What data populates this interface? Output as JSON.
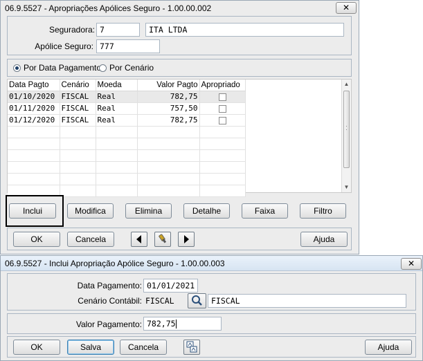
{
  "window1": {
    "title": "06.9.5527 - Apropriações Apólices Seguro - 1.00.00.002",
    "close_label": "✕",
    "seguradora_label": "Seguradora:",
    "seguradora_code": "7",
    "seguradora_name": "ITA LTDA",
    "apolice_label": "Apólice Seguro:",
    "apolice_value": "777",
    "radio_data_label": "Por Data Pagamento",
    "radio_cenario_label": "Por Cenário",
    "selected_radio": "Por Data Pagamento",
    "grid": {
      "columns": [
        "Data Pagto",
        "Cenário",
        "Moeda",
        "Valor Pagto",
        "Apropriado"
      ],
      "rows": [
        [
          "01/10/2020",
          "FISCAL",
          "Real",
          "782,75",
          false
        ],
        [
          "01/11/2020",
          "FISCAL",
          "Real",
          "757,50",
          false
        ],
        [
          "01/12/2020",
          "FISCAL",
          "Real",
          "782,75",
          false
        ]
      ]
    },
    "buttons": {
      "inclui": "Inclui",
      "modifica": "Modifica",
      "elimina": "Elimina",
      "detalhe": "Detalhe",
      "faixa": "Faixa",
      "filtro": "Filtro",
      "ok": "OK",
      "cancela": "Cancela",
      "ajuda": "Ajuda"
    }
  },
  "window2": {
    "title": "06.9.5527 - Inclui Apropriação Apólice Seguro - 1.00.00.003",
    "close_label": "✕",
    "data_pagamento_label": "Data Pagamento:",
    "data_pagamento_value": "01/01/2021",
    "cenario_label": "Cenário Contábil:",
    "cenario_code": "FISCAL",
    "cenario_name": "FISCAL",
    "valor_label": "Valor Pagamento:",
    "valor_value": "782,75",
    "buttons": {
      "ok": "OK",
      "salva": "Salva",
      "cancela": "Cancela",
      "ajuda": "Ajuda"
    }
  }
}
